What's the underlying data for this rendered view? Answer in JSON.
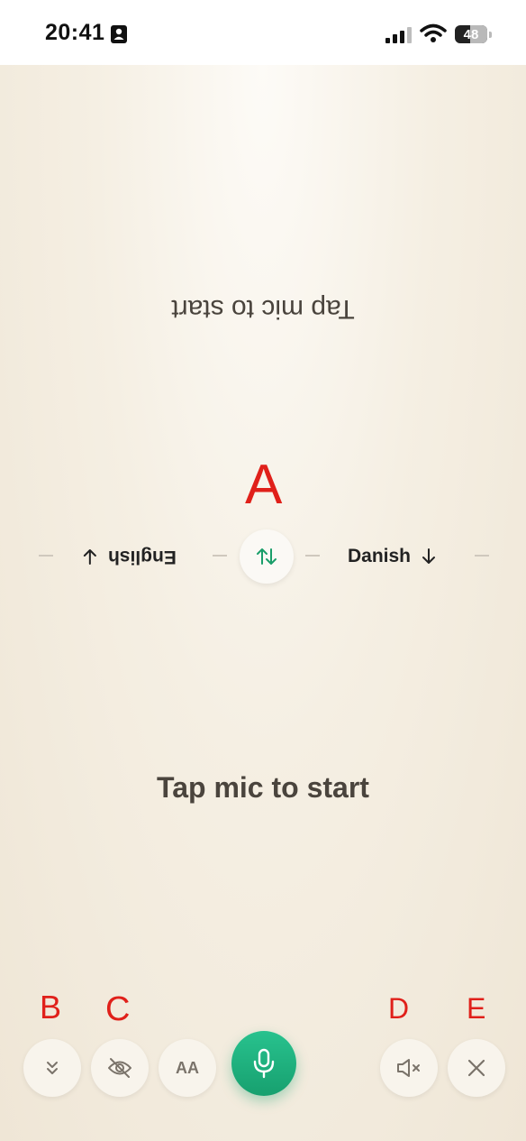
{
  "status_bar": {
    "time": "20:41",
    "battery": "48",
    "battery_level": 0.48
  },
  "conversation": {
    "partner_prompt": "Tap mic to start",
    "my_prompt": "Tap mic to start"
  },
  "languages": {
    "partner": "English",
    "mine": "Danish",
    "accent_color": "#1a9e6a"
  },
  "annotations": {
    "a": "A",
    "b": "B",
    "c": "C",
    "d": "D",
    "e": "E",
    "color": "#e0201a"
  },
  "toolbar": {
    "text_size_label": "AA",
    "mic_color": "#1faf7e",
    "icons": [
      "chevrons-down-icon",
      "eye-off-icon",
      "text-size-icon",
      "mic-icon",
      "volume-mute-icon",
      "close-icon"
    ]
  }
}
